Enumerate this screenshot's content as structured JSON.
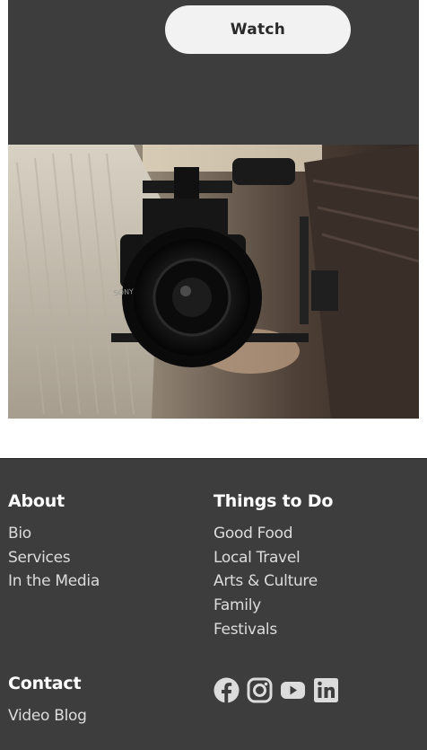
{
  "hero": {
    "watch_label": "Watch"
  },
  "footer": {
    "about": {
      "heading": "About",
      "links": [
        "Bio",
        "Services",
        "In the Media"
      ]
    },
    "things_to_do": {
      "heading": "Things to Do",
      "links": [
        "Good Food",
        "Local Travel",
        "Arts & Culture",
        "Family",
        "Festivals"
      ]
    },
    "contact": {
      "heading": "Contact",
      "links": [
        "Video Blog"
      ]
    },
    "social_icons": [
      "facebook-icon",
      "instagram-icon",
      "youtube-icon",
      "linkedin-icon"
    ]
  },
  "colors": {
    "dark_bg": "#3d3d3d",
    "button_bg": "#f2f2f2",
    "heading_text": "#ffffff",
    "link_text": "#dcdcdc"
  }
}
